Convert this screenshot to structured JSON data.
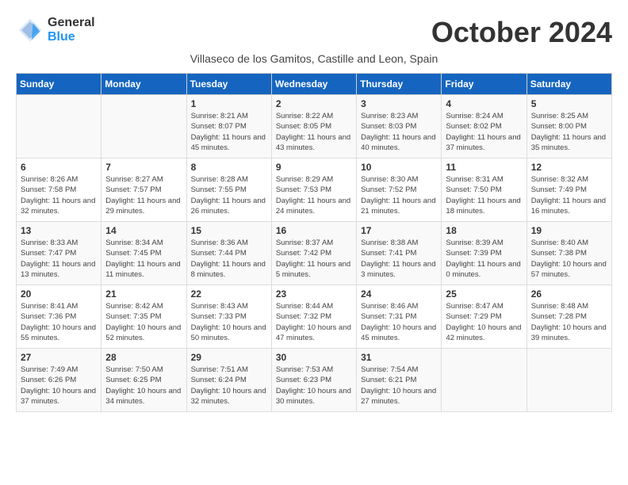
{
  "logo": {
    "general": "General",
    "blue": "Blue"
  },
  "title": "October 2024",
  "subtitle": "Villaseco de los Gamitos, Castille and Leon, Spain",
  "days_of_week": [
    "Sunday",
    "Monday",
    "Tuesday",
    "Wednesday",
    "Thursday",
    "Friday",
    "Saturday"
  ],
  "weeks": [
    [
      {
        "day": "",
        "info": ""
      },
      {
        "day": "",
        "info": ""
      },
      {
        "day": "1",
        "info": "Sunrise: 8:21 AM\nSunset: 8:07 PM\nDaylight: 11 hours and 45 minutes."
      },
      {
        "day": "2",
        "info": "Sunrise: 8:22 AM\nSunset: 8:05 PM\nDaylight: 11 hours and 43 minutes."
      },
      {
        "day": "3",
        "info": "Sunrise: 8:23 AM\nSunset: 8:03 PM\nDaylight: 11 hours and 40 minutes."
      },
      {
        "day": "4",
        "info": "Sunrise: 8:24 AM\nSunset: 8:02 PM\nDaylight: 11 hours and 37 minutes."
      },
      {
        "day": "5",
        "info": "Sunrise: 8:25 AM\nSunset: 8:00 PM\nDaylight: 11 hours and 35 minutes."
      }
    ],
    [
      {
        "day": "6",
        "info": "Sunrise: 8:26 AM\nSunset: 7:58 PM\nDaylight: 11 hours and 32 minutes."
      },
      {
        "day": "7",
        "info": "Sunrise: 8:27 AM\nSunset: 7:57 PM\nDaylight: 11 hours and 29 minutes."
      },
      {
        "day": "8",
        "info": "Sunrise: 8:28 AM\nSunset: 7:55 PM\nDaylight: 11 hours and 26 minutes."
      },
      {
        "day": "9",
        "info": "Sunrise: 8:29 AM\nSunset: 7:53 PM\nDaylight: 11 hours and 24 minutes."
      },
      {
        "day": "10",
        "info": "Sunrise: 8:30 AM\nSunset: 7:52 PM\nDaylight: 11 hours and 21 minutes."
      },
      {
        "day": "11",
        "info": "Sunrise: 8:31 AM\nSunset: 7:50 PM\nDaylight: 11 hours and 18 minutes."
      },
      {
        "day": "12",
        "info": "Sunrise: 8:32 AM\nSunset: 7:49 PM\nDaylight: 11 hours and 16 minutes."
      }
    ],
    [
      {
        "day": "13",
        "info": "Sunrise: 8:33 AM\nSunset: 7:47 PM\nDaylight: 11 hours and 13 minutes."
      },
      {
        "day": "14",
        "info": "Sunrise: 8:34 AM\nSunset: 7:45 PM\nDaylight: 11 hours and 11 minutes."
      },
      {
        "day": "15",
        "info": "Sunrise: 8:36 AM\nSunset: 7:44 PM\nDaylight: 11 hours and 8 minutes."
      },
      {
        "day": "16",
        "info": "Sunrise: 8:37 AM\nSunset: 7:42 PM\nDaylight: 11 hours and 5 minutes."
      },
      {
        "day": "17",
        "info": "Sunrise: 8:38 AM\nSunset: 7:41 PM\nDaylight: 11 hours and 3 minutes."
      },
      {
        "day": "18",
        "info": "Sunrise: 8:39 AM\nSunset: 7:39 PM\nDaylight: 11 hours and 0 minutes."
      },
      {
        "day": "19",
        "info": "Sunrise: 8:40 AM\nSunset: 7:38 PM\nDaylight: 10 hours and 57 minutes."
      }
    ],
    [
      {
        "day": "20",
        "info": "Sunrise: 8:41 AM\nSunset: 7:36 PM\nDaylight: 10 hours and 55 minutes."
      },
      {
        "day": "21",
        "info": "Sunrise: 8:42 AM\nSunset: 7:35 PM\nDaylight: 10 hours and 52 minutes."
      },
      {
        "day": "22",
        "info": "Sunrise: 8:43 AM\nSunset: 7:33 PM\nDaylight: 10 hours and 50 minutes."
      },
      {
        "day": "23",
        "info": "Sunrise: 8:44 AM\nSunset: 7:32 PM\nDaylight: 10 hours and 47 minutes."
      },
      {
        "day": "24",
        "info": "Sunrise: 8:46 AM\nSunset: 7:31 PM\nDaylight: 10 hours and 45 minutes."
      },
      {
        "day": "25",
        "info": "Sunrise: 8:47 AM\nSunset: 7:29 PM\nDaylight: 10 hours and 42 minutes."
      },
      {
        "day": "26",
        "info": "Sunrise: 8:48 AM\nSunset: 7:28 PM\nDaylight: 10 hours and 39 minutes."
      }
    ],
    [
      {
        "day": "27",
        "info": "Sunrise: 7:49 AM\nSunset: 6:26 PM\nDaylight: 10 hours and 37 minutes."
      },
      {
        "day": "28",
        "info": "Sunrise: 7:50 AM\nSunset: 6:25 PM\nDaylight: 10 hours and 34 minutes."
      },
      {
        "day": "29",
        "info": "Sunrise: 7:51 AM\nSunset: 6:24 PM\nDaylight: 10 hours and 32 minutes."
      },
      {
        "day": "30",
        "info": "Sunrise: 7:53 AM\nSunset: 6:23 PM\nDaylight: 10 hours and 30 minutes."
      },
      {
        "day": "31",
        "info": "Sunrise: 7:54 AM\nSunset: 6:21 PM\nDaylight: 10 hours and 27 minutes."
      },
      {
        "day": "",
        "info": ""
      },
      {
        "day": "",
        "info": ""
      }
    ]
  ]
}
